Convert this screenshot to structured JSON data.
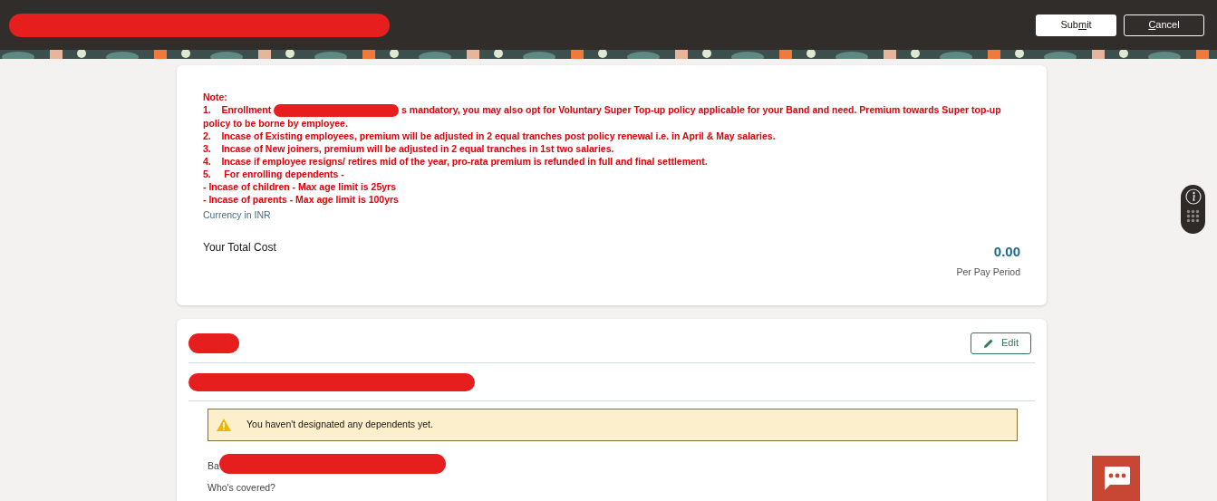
{
  "header": {
    "buttons": [
      {
        "kind": "primary",
        "before": "Sub",
        "key": "m",
        "after": "it"
      },
      {
        "kind": "secondary",
        "key": "C",
        "after": "ancel"
      }
    ]
  },
  "summary": {
    "note_title": "Note:",
    "note_lines": [
      {
        "kind": "redacted",
        "before": "1.    Enrollment",
        "after": "s mandatory, you may also opt for Voluntary Super Top-up policy applicable for your Band and need. Premium towards Super top-up policy to be borne by employee."
      },
      {
        "kind": "plain",
        "text": "2.    Incase of Existing employees, premium will be adjusted in 2 equal tranches post policy renewal i.e. in April & May salaries."
      },
      {
        "kind": "plain",
        "text": "3.    Incase of New joiners, premium will be adjusted in 2 equal tranches in 1st two salaries."
      },
      {
        "kind": "plain",
        "text": "4.    Incase if employee resigns/ retires mid of the year, pro-rata premium is refunded in full and final settlement."
      },
      {
        "kind": "plain",
        "text": "5.     For enrolling dependents -"
      },
      {
        "kind": "plain",
        "text": "- Incase of children - Max age limit is 25yrs"
      },
      {
        "kind": "plain",
        "text": "- Incase of parents - Max age limit is 100yrs"
      }
    ],
    "currency": "Currency in INR",
    "total_label": "Your Total Cost",
    "total_value": "0.00",
    "period": "Per Pay Period"
  },
  "plan": {
    "edit_button": "Edit",
    "warning": "You haven't designated any dependents yet.",
    "partial_label": "Ba",
    "covered_label": "Who's covered?"
  }
}
